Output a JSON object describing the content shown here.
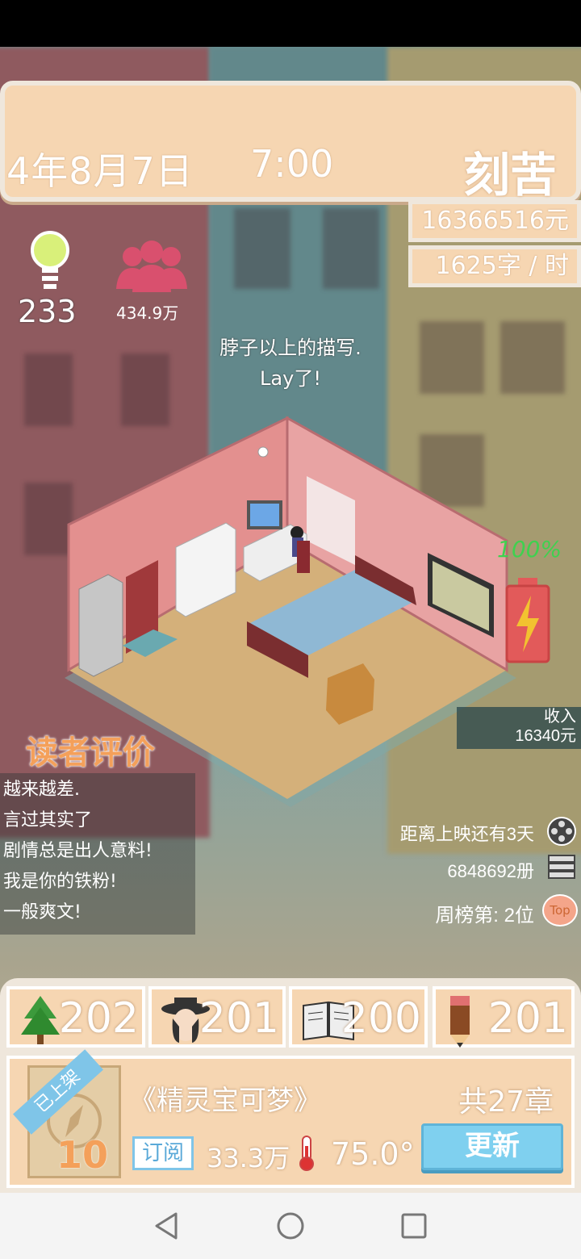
{
  "header": {
    "date": "4年8月7日",
    "time": "7:00",
    "mood": "刻苦",
    "money": "16366516元",
    "speed": "1625字 / 时"
  },
  "stats": {
    "ideas": "233",
    "fans": "434.9万"
  },
  "speech": {
    "line1": "脖子以上的描写.",
    "line2": "Lay了!"
  },
  "battery": {
    "percent_label": "100%",
    "level": 1.0
  },
  "income": {
    "label": "收入",
    "value": "16340元"
  },
  "reviews": {
    "title": "读者评价",
    "items": [
      "越来越差.",
      "言过其实了",
      "剧情总是出人意料!",
      "我是你的铁粉!",
      "一般爽文!"
    ]
  },
  "info": {
    "premiere": "距离上映还有3天",
    "copies": "6848692册",
    "rank": "周榜第: 2位",
    "top_badge": "Top"
  },
  "attributes": [
    {
      "icon": "tree-icon",
      "value": "202"
    },
    {
      "icon": "character-icon",
      "value": "201"
    },
    {
      "icon": "open-book-icon",
      "value": "200"
    },
    {
      "icon": "pencil-icon",
      "value": "201"
    }
  ],
  "book": {
    "status": "已上架",
    "level": "10",
    "title": "《精灵宝可梦》",
    "chapters": "共27章",
    "subscribe_label": "订阅",
    "subscribers": "33.3万",
    "heat": "75.0°",
    "update_label": "更新"
  },
  "colors": {
    "accent_orange": "#f4a05a",
    "panel": "#f6d6b2",
    "battery_green": "#3fd14f",
    "button_blue": "#7fd0ef"
  }
}
